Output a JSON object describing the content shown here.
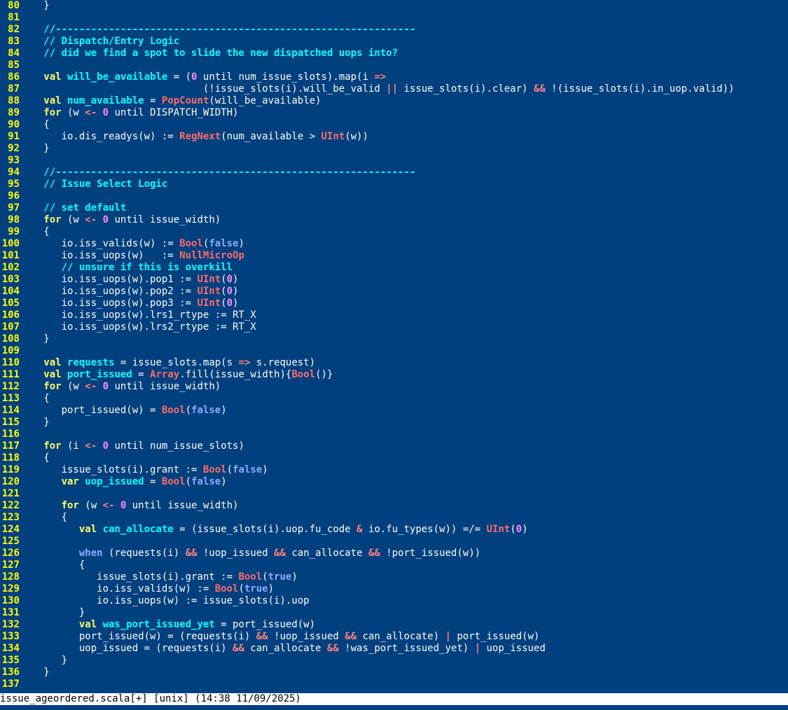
{
  "editor": {
    "lines": [
      {
        "n": "80",
        "t": [
          [
            "pl",
            "   }"
          ]
        ]
      },
      {
        "n": "81",
        "t": []
      },
      {
        "n": "82",
        "t": [
          [
            "cm",
            "   //-------------------------------------------------------------"
          ]
        ]
      },
      {
        "n": "83",
        "t": [
          [
            "cm",
            "   // Dispatch/Entry Logic"
          ]
        ]
      },
      {
        "n": "84",
        "t": [
          [
            "cm",
            "   // did we find a spot to slide the new dispatched uops into?"
          ]
        ]
      },
      {
        "n": "85",
        "t": []
      },
      {
        "n": "86",
        "t": [
          [
            "kw",
            "   val "
          ],
          [
            "ident",
            "will_be_available"
          ],
          [
            "pl",
            " = ("
          ],
          [
            "num",
            "0"
          ],
          [
            "pl",
            " until num_issue_slots).map(i "
          ],
          [
            "op",
            "=>"
          ]
        ]
      },
      {
        "n": "87",
        "t": [
          [
            "pl",
            "                              (!issue_slots(i).will_be_valid "
          ],
          [
            "op",
            "||"
          ],
          [
            "pl",
            " issue_slots(i).clear) "
          ],
          [
            "op",
            "&&"
          ],
          [
            "pl",
            " !(issue_slots(i).in_uop.valid))"
          ]
        ]
      },
      {
        "n": "88",
        "t": [
          [
            "kw",
            "   val "
          ],
          [
            "ident",
            "num_available"
          ],
          [
            "pl",
            " = "
          ],
          [
            "ty",
            "PopCount"
          ],
          [
            "pl",
            "(will_be_available)"
          ]
        ]
      },
      {
        "n": "89",
        "t": [
          [
            "kw",
            "   for"
          ],
          [
            "pl",
            " (w "
          ],
          [
            "op",
            "<-"
          ],
          [
            "pl",
            " "
          ],
          [
            "num",
            "0"
          ],
          [
            "pl",
            " until DISPATCH_WIDTH)"
          ]
        ]
      },
      {
        "n": "90",
        "t": [
          [
            "pl",
            "   {"
          ]
        ]
      },
      {
        "n": "91",
        "t": [
          [
            "pl",
            "      io.dis_readys(w) := "
          ],
          [
            "ty",
            "RegNext"
          ],
          [
            "pl",
            "(num_available > "
          ],
          [
            "ty",
            "UInt"
          ],
          [
            "pl",
            "(w))"
          ]
        ]
      },
      {
        "n": "92",
        "t": [
          [
            "pl",
            "   }"
          ]
        ]
      },
      {
        "n": "93",
        "t": []
      },
      {
        "n": "94",
        "t": [
          [
            "cm",
            "   //-------------------------------------------------------------"
          ]
        ]
      },
      {
        "n": "95",
        "t": [
          [
            "cm",
            "   // Issue Select Logic"
          ]
        ]
      },
      {
        "n": "96",
        "t": []
      },
      {
        "n": "97",
        "t": [
          [
            "cm",
            "   // set default"
          ]
        ]
      },
      {
        "n": "98",
        "t": [
          [
            "kw",
            "   for"
          ],
          [
            "pl",
            " (w "
          ],
          [
            "op",
            "<-"
          ],
          [
            "pl",
            " "
          ],
          [
            "num",
            "0"
          ],
          [
            "pl",
            " until issue_width)"
          ]
        ]
      },
      {
        "n": "99",
        "t": [
          [
            "pl",
            "   {"
          ]
        ]
      },
      {
        "n": "100",
        "t": [
          [
            "pl",
            "      io.iss_valids(w) := "
          ],
          [
            "ty",
            "Bool"
          ],
          [
            "pl",
            "("
          ],
          [
            "lit",
            "false"
          ],
          [
            "pl",
            ")"
          ]
        ]
      },
      {
        "n": "101",
        "t": [
          [
            "pl",
            "      io.iss_uops(w)   := "
          ],
          [
            "ty",
            "NullMicroOp"
          ]
        ]
      },
      {
        "n": "102",
        "t": [
          [
            "cm",
            "      // unsure if this is overkill"
          ]
        ]
      },
      {
        "n": "103",
        "t": [
          [
            "pl",
            "      io.iss_uops(w).pop1 := "
          ],
          [
            "ty",
            "UInt"
          ],
          [
            "pl",
            "("
          ],
          [
            "num",
            "0"
          ],
          [
            "pl",
            ")"
          ]
        ]
      },
      {
        "n": "104",
        "t": [
          [
            "pl",
            "      io.iss_uops(w).pop2 := "
          ],
          [
            "ty",
            "UInt"
          ],
          [
            "pl",
            "("
          ],
          [
            "num",
            "0"
          ],
          [
            "pl",
            ")"
          ]
        ]
      },
      {
        "n": "105",
        "t": [
          [
            "pl",
            "      io.iss_uops(w).pop3 := "
          ],
          [
            "ty",
            "UInt"
          ],
          [
            "pl",
            "("
          ],
          [
            "num",
            "0"
          ],
          [
            "pl",
            ")"
          ]
        ]
      },
      {
        "n": "106",
        "t": [
          [
            "pl",
            "      io.iss_uops(w).lrs1_rtype := RT_X"
          ]
        ]
      },
      {
        "n": "107",
        "t": [
          [
            "pl",
            "      io.iss_uops(w).lrs2_rtype := RT_X"
          ]
        ]
      },
      {
        "n": "108",
        "t": [
          [
            "pl",
            "   }"
          ]
        ]
      },
      {
        "n": "109",
        "t": []
      },
      {
        "n": "110",
        "t": [
          [
            "kw",
            "   val "
          ],
          [
            "ident",
            "requests"
          ],
          [
            "pl",
            " = issue_slots.map(s "
          ],
          [
            "op",
            "=>"
          ],
          [
            "pl",
            " s.request)"
          ]
        ]
      },
      {
        "n": "111",
        "t": [
          [
            "kw",
            "   val "
          ],
          [
            "ident",
            "port_issued"
          ],
          [
            "pl",
            " = "
          ],
          [
            "ty",
            "Array"
          ],
          [
            "pl",
            ".fill(issue_width){"
          ],
          [
            "ty",
            "Bool"
          ],
          [
            "pl",
            "()}"
          ]
        ]
      },
      {
        "n": "112",
        "t": [
          [
            "kw",
            "   for"
          ],
          [
            "pl",
            " (w "
          ],
          [
            "op",
            "<-"
          ],
          [
            "pl",
            " "
          ],
          [
            "num",
            "0"
          ],
          [
            "pl",
            " until issue_width)"
          ]
        ]
      },
      {
        "n": "113",
        "t": [
          [
            "pl",
            "   {"
          ]
        ]
      },
      {
        "n": "114",
        "t": [
          [
            "pl",
            "      port_issued(w) = "
          ],
          [
            "ty",
            "Bool"
          ],
          [
            "pl",
            "("
          ],
          [
            "lit",
            "false"
          ],
          [
            "pl",
            ")"
          ]
        ]
      },
      {
        "n": "115",
        "t": [
          [
            "pl",
            "   }"
          ]
        ]
      },
      {
        "n": "116",
        "t": []
      },
      {
        "n": "117",
        "t": [
          [
            "kw",
            "   for"
          ],
          [
            "pl",
            " (i "
          ],
          [
            "op",
            "<-"
          ],
          [
            "pl",
            " "
          ],
          [
            "num",
            "0"
          ],
          [
            "pl",
            " until num_issue_slots)"
          ]
        ]
      },
      {
        "n": "118",
        "t": [
          [
            "pl",
            "   {"
          ]
        ]
      },
      {
        "n": "119",
        "t": [
          [
            "pl",
            "      issue_slots(i).grant := "
          ],
          [
            "ty",
            "Bool"
          ],
          [
            "pl",
            "("
          ],
          [
            "lit",
            "false"
          ],
          [
            "pl",
            ")"
          ]
        ]
      },
      {
        "n": "120",
        "t": [
          [
            "kw",
            "      var "
          ],
          [
            "ident",
            "uop_issued"
          ],
          [
            "pl",
            " = "
          ],
          [
            "ty",
            "Bool"
          ],
          [
            "pl",
            "("
          ],
          [
            "lit",
            "false"
          ],
          [
            "pl",
            ")"
          ]
        ]
      },
      {
        "n": "121",
        "t": []
      },
      {
        "n": "122",
        "t": [
          [
            "kw",
            "      for"
          ],
          [
            "pl",
            " (w "
          ],
          [
            "op",
            "<-"
          ],
          [
            "pl",
            " "
          ],
          [
            "num",
            "0"
          ],
          [
            "pl",
            " until issue_width)"
          ]
        ]
      },
      {
        "n": "123",
        "t": [
          [
            "pl",
            "      {"
          ]
        ]
      },
      {
        "n": "124",
        "t": [
          [
            "kw",
            "         val "
          ],
          [
            "ident",
            "can_allocate"
          ],
          [
            "pl",
            " = (issue_slots(i).uop.fu_code "
          ],
          [
            "op",
            "&"
          ],
          [
            "pl",
            " io.fu_types(w)) =/= "
          ],
          [
            "ty",
            "UInt"
          ],
          [
            "pl",
            "("
          ],
          [
            "num",
            "0"
          ],
          [
            "pl",
            ")"
          ]
        ]
      },
      {
        "n": "125",
        "t": []
      },
      {
        "n": "126",
        "t": [
          [
            "lit",
            "         when"
          ],
          [
            "pl",
            " (requests(i) "
          ],
          [
            "op",
            "&&"
          ],
          [
            "pl",
            " !uop_issued "
          ],
          [
            "op",
            "&&"
          ],
          [
            "pl",
            " can_allocate "
          ],
          [
            "op",
            "&&"
          ],
          [
            "pl",
            " !port_issued(w))"
          ]
        ]
      },
      {
        "n": "127",
        "t": [
          [
            "pl",
            "         {"
          ]
        ]
      },
      {
        "n": "128",
        "t": [
          [
            "pl",
            "            issue_slots(i).grant := "
          ],
          [
            "ty",
            "Bool"
          ],
          [
            "pl",
            "("
          ],
          [
            "lit",
            "true"
          ],
          [
            "pl",
            ")"
          ]
        ]
      },
      {
        "n": "129",
        "t": [
          [
            "pl",
            "            io.iss_valids(w) := "
          ],
          [
            "ty",
            "Bool"
          ],
          [
            "pl",
            "("
          ],
          [
            "lit",
            "true"
          ],
          [
            "pl",
            ")"
          ]
        ]
      },
      {
        "n": "130",
        "t": [
          [
            "pl",
            "            io.iss_uops(w) := issue_slots(i).uop"
          ]
        ]
      },
      {
        "n": "131",
        "t": [
          [
            "pl",
            "         }"
          ]
        ]
      },
      {
        "n": "132",
        "t": [
          [
            "kw",
            "         val "
          ],
          [
            "ident",
            "was_port_issued_yet"
          ],
          [
            "pl",
            " = port_issued(w)"
          ]
        ]
      },
      {
        "n": "133",
        "t": [
          [
            "pl",
            "         port_issued(w) = (requests(i) "
          ],
          [
            "op",
            "&&"
          ],
          [
            "pl",
            " !uop_issued "
          ],
          [
            "op",
            "&&"
          ],
          [
            "pl",
            " can_allocate) "
          ],
          [
            "op",
            "|"
          ],
          [
            "pl",
            " port_issued(w)"
          ]
        ]
      },
      {
        "n": "134",
        "t": [
          [
            "pl",
            "         uop_issued = (requests(i) "
          ],
          [
            "op",
            "&&"
          ],
          [
            "pl",
            " can_allocate "
          ],
          [
            "op",
            "&&"
          ],
          [
            "pl",
            " !was_port_issued_yet) "
          ],
          [
            "op",
            "|"
          ],
          [
            "pl",
            " uop_issued"
          ]
        ]
      },
      {
        "n": "135",
        "t": [
          [
            "pl",
            "      }"
          ]
        ]
      },
      {
        "n": "136",
        "t": [
          [
            "pl",
            "   }"
          ]
        ]
      },
      {
        "n": "137",
        "t": []
      }
    ]
  },
  "statusbar": {
    "text": "issue_ageordered.scala[+] [unix] (14:38 11/09/2025)"
  },
  "colors": {
    "background": "#00407f",
    "line_number": "#ffff00",
    "keyword": "#ffff66",
    "type": "#ff6b6b",
    "number": "#ff88ff",
    "operator": "#ff8080",
    "comment": "#00ffff",
    "literal": "#8fa9ff"
  }
}
